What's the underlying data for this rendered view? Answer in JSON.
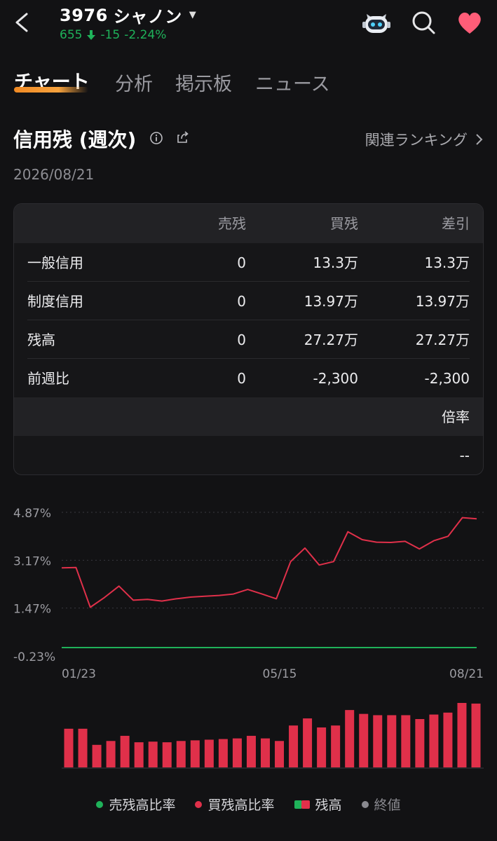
{
  "header": {
    "ticker": "3976",
    "name": "シャノン",
    "price": "655",
    "change": "-15",
    "change_pct": "-2.24%",
    "down_color": "#1fb25a"
  },
  "tabs": [
    {
      "label": "チャート",
      "active": true
    },
    {
      "label": "分析",
      "active": false
    },
    {
      "label": "掲示板",
      "active": false
    },
    {
      "label": "ニュース",
      "active": false
    }
  ],
  "section": {
    "title": "信用残 (週次)",
    "ranking_link": "関連ランキング",
    "date": "2026/08/21"
  },
  "table": {
    "headers": [
      "",
      "売残",
      "買残",
      "差引"
    ],
    "rows": [
      [
        "一般信用",
        "0",
        "13.3万",
        "13.3万"
      ],
      [
        "制度信用",
        "0",
        "13.97万",
        "13.97万"
      ],
      [
        "残高",
        "0",
        "27.27万",
        "27.27万"
      ],
      [
        "前週比",
        "0",
        "-2,300",
        "-2,300"
      ]
    ],
    "ratio_label": "倍率",
    "ratio_value": "--"
  },
  "chart_data": {
    "type": "line",
    "y_ticks": [
      "4.87%",
      "3.17%",
      "1.47%",
      "-0.23%"
    ],
    "ylim": [
      -0.23,
      4.87
    ],
    "x_ticks": [
      "01/23",
      "05/15",
      "08/21"
    ],
    "series": [
      {
        "name": "買残高比率",
        "color": "#e0304a",
        "values": [
          2.9,
          2.91,
          1.5,
          1.85,
          2.25,
          1.75,
          1.78,
          1.72,
          1.8,
          1.86,
          1.89,
          1.92,
          1.97,
          2.13,
          1.97,
          1.8,
          3.12,
          3.6,
          3.0,
          3.12,
          4.18,
          3.9,
          3.81,
          3.8,
          3.84,
          3.57,
          3.86,
          4.02,
          4.68,
          4.64
        ]
      },
      {
        "name": "売残高比率",
        "color": "#1fb25a",
        "values": [
          0,
          0,
          0,
          0,
          0,
          0,
          0,
          0,
          0,
          0,
          0,
          0,
          0,
          0,
          0,
          0,
          0,
          0,
          0,
          0,
          0,
          0,
          0,
          0,
          0,
          0,
          0,
          0,
          0,
          0
        ]
      }
    ],
    "bars": {
      "name": "残高",
      "color": "#e0304a",
      "values": [
        0.6,
        0.6,
        0.35,
        0.41,
        0.49,
        0.39,
        0.4,
        0.39,
        0.41,
        0.42,
        0.43,
        0.44,
        0.45,
        0.49,
        0.45,
        0.41,
        0.65,
        0.76,
        0.62,
        0.65,
        0.89,
        0.83,
        0.81,
        0.81,
        0.81,
        0.75,
        0.82,
        0.85,
        1.0,
        0.99
      ]
    },
    "legend": [
      {
        "label": "売残高比率",
        "color": "#1fb25a",
        "shape": "dot"
      },
      {
        "label": "買残高比率",
        "color": "#e0304a",
        "shape": "dot"
      },
      {
        "label": "残高",
        "color": "#e0304a",
        "shape": "bar"
      },
      {
        "label": "終値",
        "color": "#8a8a90",
        "shape": "dot"
      }
    ]
  }
}
